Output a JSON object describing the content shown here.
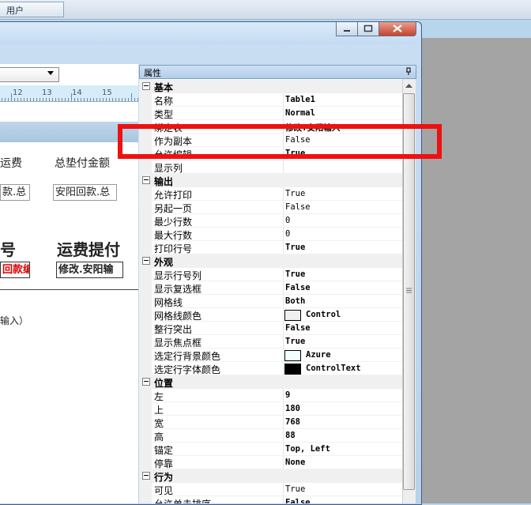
{
  "taskbar": {
    "user_tab": "用户"
  },
  "designer": {
    "ruler_marks": [
      "12",
      "13",
      "14",
      "15"
    ],
    "labels": {
      "freight": "运费",
      "total_advance": "总垫付金额",
      "hao": "号",
      "freight_pay": "运费提付",
      "note": "输入）"
    },
    "boxes": {
      "box1": "款.总",
      "box2": "安阳回款.总",
      "box3": "回款编",
      "box4": "修改.安阳输"
    }
  },
  "property_grid": {
    "title": "属性",
    "pin_icon": "pin-icon",
    "categories": [
      {
        "name": "基本",
        "rows": [
          {
            "name": "名称",
            "value": "Table1",
            "bold": true
          },
          {
            "name": "类型",
            "value": "Normal",
            "bold": true
          },
          {
            "name": "绑定表",
            "value": "修改.安阳输入",
            "bold": true
          },
          {
            "name": "作为副本",
            "value": "False",
            "bold": false
          },
          {
            "name": "允许编辑",
            "value": "True",
            "bold": true
          },
          {
            "name": "显示列",
            "value": "",
            "bold": false
          }
        ]
      },
      {
        "name": "输出",
        "rows": [
          {
            "name": "允许打印",
            "value": "True",
            "bold": false
          },
          {
            "name": "另起一页",
            "value": "False",
            "bold": false
          },
          {
            "name": "最少行数",
            "value": "0",
            "bold": false
          },
          {
            "name": "最大行数",
            "value": "0",
            "bold": false
          },
          {
            "name": "打印行号",
            "value": "True",
            "bold": true
          }
        ]
      },
      {
        "name": "外观",
        "rows": [
          {
            "name": "显示行号列",
            "value": "True",
            "bold": true
          },
          {
            "name": "显示复选框",
            "value": "False",
            "bold": true
          },
          {
            "name": "网格线",
            "value": "Both",
            "bold": true
          },
          {
            "name": "网格线颜色",
            "value": "Control",
            "bold": true,
            "swatch": "#f0f0f0"
          },
          {
            "name": "整行突出",
            "value": "False",
            "bold": true
          },
          {
            "name": "显示焦点框",
            "value": "True",
            "bold": true
          },
          {
            "name": "选定行背景颜色",
            "value": "Azure",
            "bold": true,
            "swatch": "#f0ffff"
          },
          {
            "name": "选定行字体颜色",
            "value": "ControlText",
            "bold": true,
            "swatch": "#000000"
          }
        ]
      },
      {
        "name": "位置",
        "rows": [
          {
            "name": "左",
            "value": "9",
            "bold": true
          },
          {
            "name": "上",
            "value": "180",
            "bold": true
          },
          {
            "name": "宽",
            "value": "768",
            "bold": true
          },
          {
            "name": "高",
            "value": "88",
            "bold": true
          },
          {
            "name": "锚定",
            "value": "Top, Left",
            "bold": true
          },
          {
            "name": "停靠",
            "value": "None",
            "bold": true
          }
        ]
      },
      {
        "name": "行为",
        "rows": [
          {
            "name": "可见",
            "value": "True",
            "bold": false
          },
          {
            "name": "允许单击排序",
            "value": "False",
            "bold": true
          }
        ]
      }
    ]
  },
  "colors": {
    "highlight": "#ee1111",
    "caption": "#c4dbf2"
  }
}
